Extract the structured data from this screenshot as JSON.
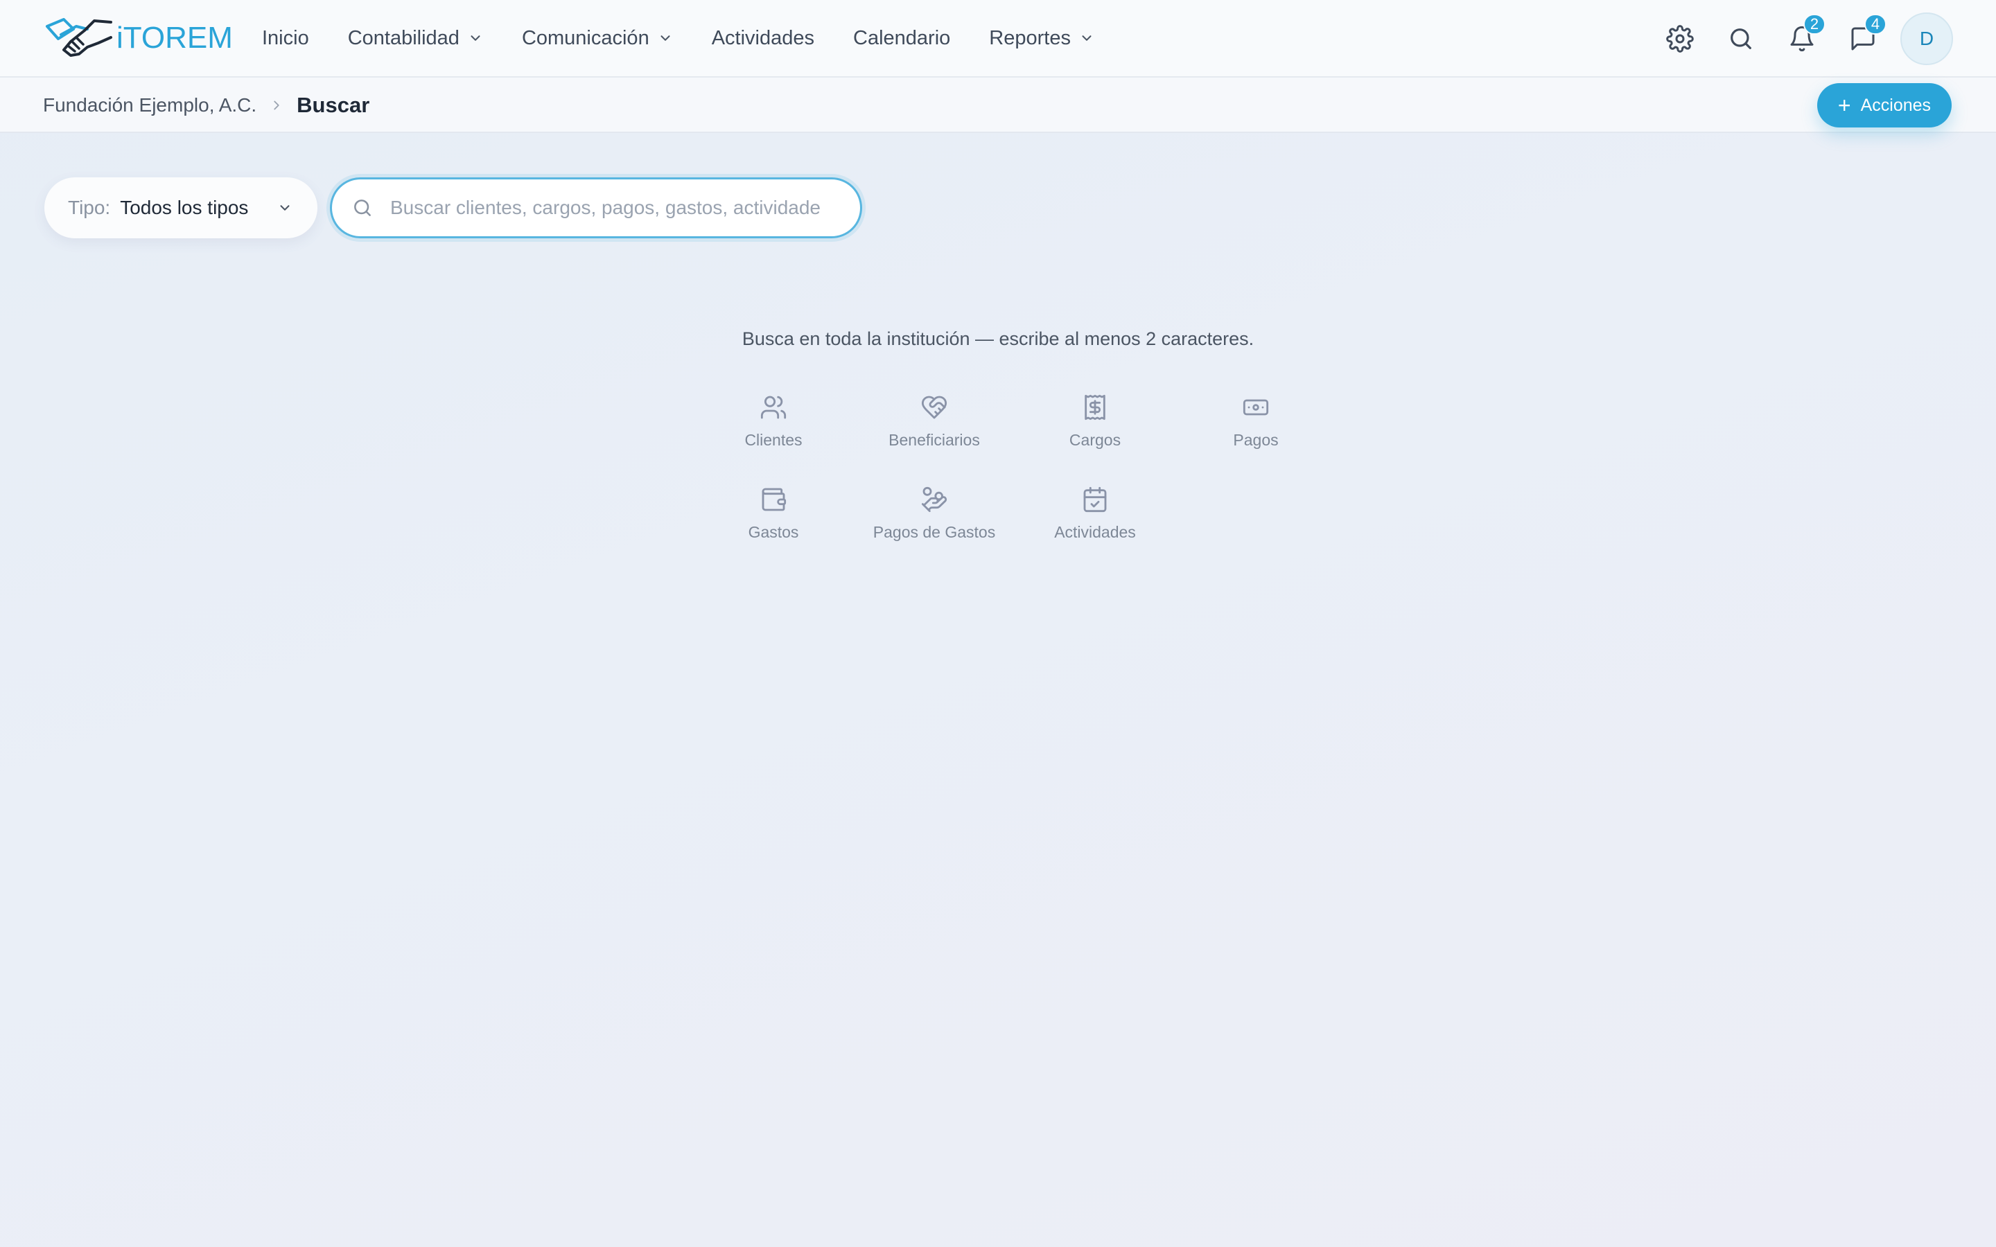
{
  "brand": {
    "name": "iTOREM"
  },
  "nav": {
    "items": [
      {
        "label": "Inicio"
      },
      {
        "label": "Contabilidad"
      },
      {
        "label": "Comunicación"
      },
      {
        "label": "Actividades"
      },
      {
        "label": "Calendario"
      },
      {
        "label": "Reportes"
      }
    ]
  },
  "header": {
    "notifications_count": "2",
    "messages_count": "4",
    "avatar_initial": "D",
    "icons": [
      "gear-icon",
      "search-icon",
      "bell-icon",
      "chat-icon"
    ]
  },
  "breadcrumb": {
    "parent": "Fundación Ejemplo, A.C.",
    "current": "Buscar"
  },
  "actions": {
    "label": "Acciones"
  },
  "filter": {
    "type_label": "Tipo:",
    "type_value": "Todos los tipos"
  },
  "search": {
    "placeholder": "Buscar clientes, cargos, pagos, gastos, actividades...",
    "value": ""
  },
  "hint": "Busca en toda la institución — escribe al menos 2 caracteres.",
  "categories": [
    {
      "label": "Clientes",
      "icon": "users-icon"
    },
    {
      "label": "Beneficiarios",
      "icon": "heart-handshake-icon"
    },
    {
      "label": "Cargos",
      "icon": "receipt-dollar-icon"
    },
    {
      "label": "Pagos",
      "icon": "banknote-icon"
    },
    {
      "label": "Gastos",
      "icon": "wallet-icon"
    },
    {
      "label": "Pagos de Gastos",
      "icon": "hand-coins-icon"
    },
    {
      "label": "Actividades",
      "icon": "calendar-check-icon"
    }
  ],
  "colors": {
    "accent": "#2aa4d8",
    "text": "#3f4a5a",
    "muted": "#7d8796"
  }
}
